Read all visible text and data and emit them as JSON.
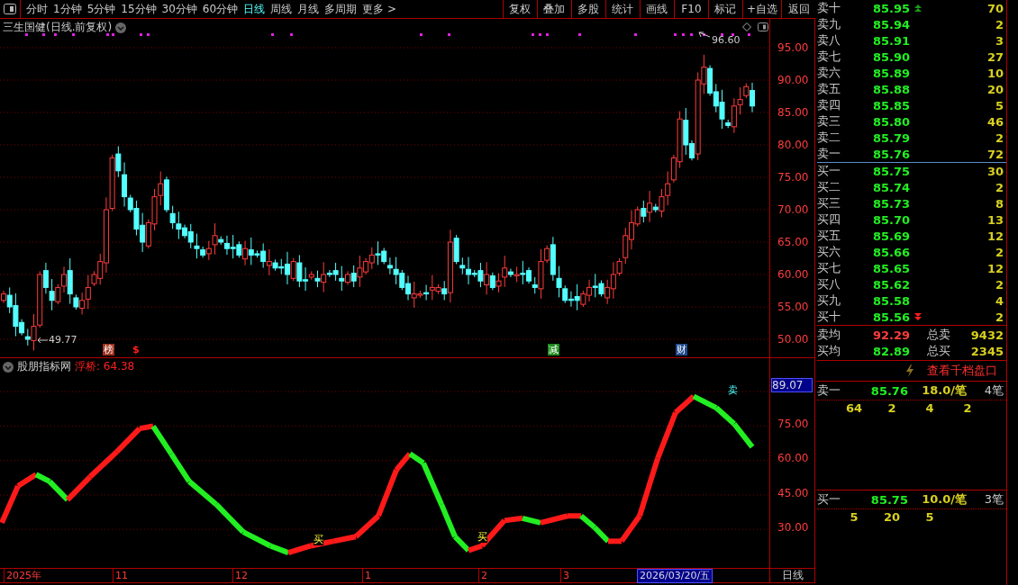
{
  "toolbar": {
    "periods": [
      {
        "label": "分时",
        "selected": false
      },
      {
        "label": "1分钟",
        "selected": false
      },
      {
        "label": "5分钟",
        "selected": false
      },
      {
        "label": "15分钟",
        "selected": false
      },
      {
        "label": "30分钟",
        "selected": false
      },
      {
        "label": "60分钟",
        "selected": false
      },
      {
        "label": "日线",
        "selected": true
      },
      {
        "label": "周线",
        "selected": false
      },
      {
        "label": "月线",
        "selected": false
      },
      {
        "label": "多周期",
        "selected": false
      },
      {
        "label": "更多 >",
        "selected": false
      }
    ],
    "buttons": [
      "复权",
      "叠加",
      "多股",
      "统计",
      "画线",
      "F10",
      "标记",
      "+自选",
      "返回"
    ]
  },
  "price_chart": {
    "title": "三生国健(日线.前复权)",
    "high_label": "96.60",
    "low_label": "49.77",
    "markers": [
      {
        "text": "榜",
        "kind": "badge",
        "color": "#a0301e"
      },
      {
        "text": "$",
        "kind": "symbol",
        "color": "#ff2020"
      },
      {
        "text": "减",
        "kind": "badge",
        "color": "#1d8a1d"
      },
      {
        "text": "财",
        "kind": "badge",
        "color": "#1e4a8c"
      }
    ],
    "y_axis": [
      "95.00",
      "90.00",
      "85.00",
      "80.00",
      "75.00",
      "70.00",
      "65.00",
      "60.00",
      "55.00",
      "50.00"
    ]
  },
  "indicator": {
    "name": "股朋指标网",
    "reading": "浮桥: 64.38",
    "current_value": "89.07",
    "y_axis": [
      "75.00",
      "60.00",
      "45.00",
      "30.00"
    ],
    "signals": [
      {
        "text": "买",
        "kind": "buy"
      },
      {
        "text": "买",
        "kind": "buy"
      },
      {
        "text": "卖",
        "kind": "sell"
      }
    ]
  },
  "time_axis": {
    "labels": [
      "2025年",
      "11",
      "12",
      "1",
      "2",
      "3"
    ],
    "cursor_date": "2026/03/20/五",
    "period": "日线"
  },
  "order_book": {
    "asks": [
      {
        "label": "卖十",
        "price": "85.95",
        "volume": "70"
      },
      {
        "label": "卖九",
        "price": "85.94",
        "volume": "2"
      },
      {
        "label": "卖八",
        "price": "85.91",
        "volume": "3"
      },
      {
        "label": "卖七",
        "price": "85.90",
        "volume": "27"
      },
      {
        "label": "卖六",
        "price": "85.89",
        "volume": "10"
      },
      {
        "label": "卖五",
        "price": "85.88",
        "volume": "20"
      },
      {
        "label": "卖四",
        "price": "85.85",
        "volume": "5"
      },
      {
        "label": "卖三",
        "price": "85.80",
        "volume": "46"
      },
      {
        "label": "卖二",
        "price": "85.79",
        "volume": "2"
      },
      {
        "label": "卖一",
        "price": "85.76",
        "volume": "72"
      }
    ],
    "bids": [
      {
        "label": "买一",
        "price": "85.75",
        "volume": "30"
      },
      {
        "label": "买二",
        "price": "85.74",
        "volume": "2"
      },
      {
        "label": "买三",
        "price": "85.73",
        "volume": "8"
      },
      {
        "label": "买四",
        "price": "85.70",
        "volume": "13"
      },
      {
        "label": "买五",
        "price": "85.69",
        "volume": "12"
      },
      {
        "label": "买六",
        "price": "85.66",
        "volume": "2"
      },
      {
        "label": "买七",
        "price": "85.65",
        "volume": "12"
      },
      {
        "label": "买八",
        "price": "85.62",
        "volume": "2"
      },
      {
        "label": "买九",
        "price": "85.58",
        "volume": "4"
      },
      {
        "label": "买十",
        "price": "85.56",
        "volume": "2"
      }
    ],
    "summary": [
      {
        "label": "卖均",
        "price": "92.29",
        "rising": true,
        "total_label": "总卖",
        "total": "9432"
      },
      {
        "label": "买均",
        "price": "82.89",
        "rising": false,
        "total_label": "总买",
        "total": "2345"
      }
    ],
    "depth_link": "查看千档盘口",
    "queues": [
      {
        "label": "卖一",
        "price": "85.76",
        "per_order": "18.0/笔",
        "orders": "4笔",
        "sizes": [
          "64",
          "2",
          "4",
          "2"
        ]
      },
      {
        "label": "买一",
        "price": "85.75",
        "per_order": "10.0/笔",
        "orders": "3笔",
        "sizes": [
          "5",
          "20",
          "5"
        ]
      }
    ]
  }
}
